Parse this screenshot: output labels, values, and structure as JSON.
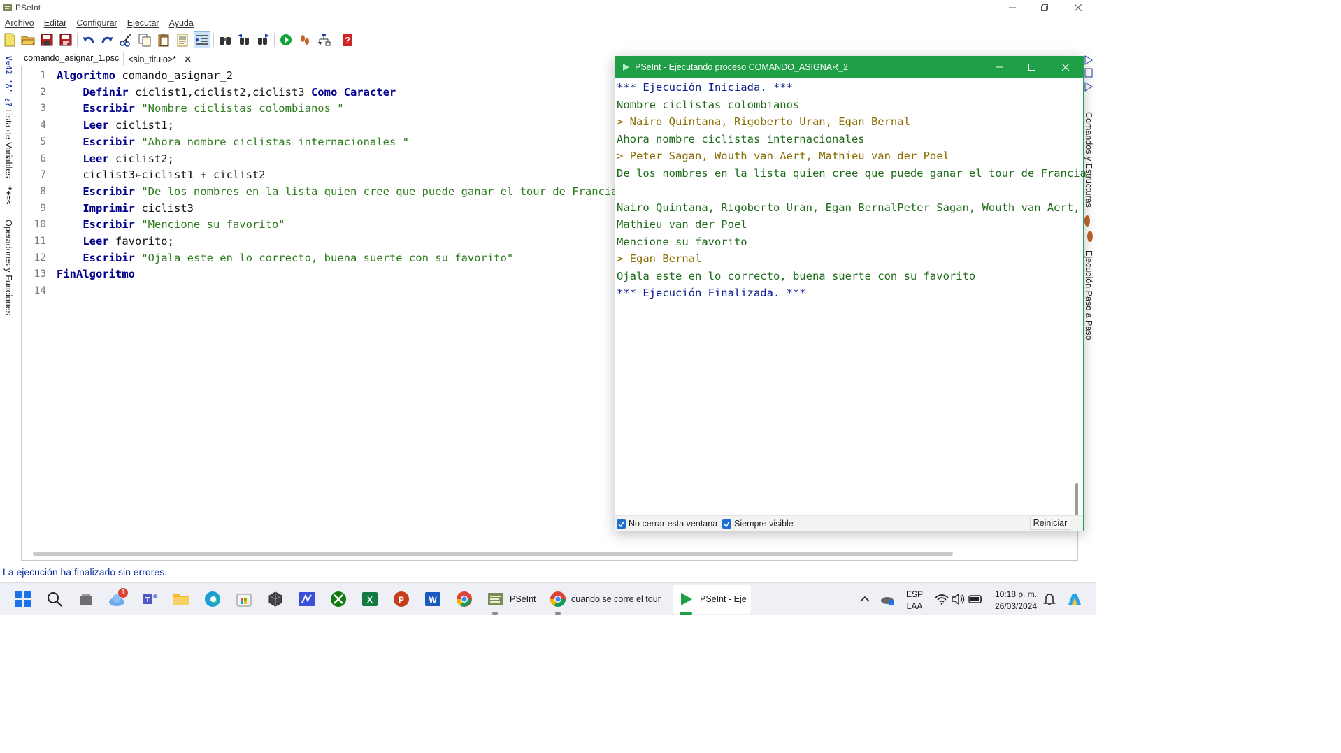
{
  "window": {
    "title": "PSeInt"
  },
  "menu": [
    "Archivo",
    "Editar",
    "Configurar",
    "Ejecutar",
    "Ayuda"
  ],
  "toolbar": {
    "icons": [
      "new-file-icon",
      "open-folder-icon",
      "save-icon",
      "save-as-icon",
      "undo-icon",
      "redo-icon",
      "cut-icon",
      "copy-icon",
      "paste-icon",
      "select-all-icon",
      "indent-icon",
      "find-icon",
      "find-previous-icon",
      "find-next-icon",
      "run-icon",
      "step-by-step-icon",
      "flowchart-icon",
      "help-icon"
    ]
  },
  "left_dock": {
    "variables_label": "Lista de Variables",
    "operators_label": "Operadores y Funciones",
    "variables_glyphs": "Ve42 'A' ¿?",
    "operators_glyphs": "*+=<"
  },
  "right_dock": {
    "commands_label": "Comandos y Estructuras",
    "step_label": "Ejecución Paso a Paso"
  },
  "tabs": [
    {
      "label": "comando_asignar_1.psc",
      "active": false
    },
    {
      "label": "<sin_titulo>*",
      "active": true,
      "close": "✕"
    }
  ],
  "editor": {
    "lines": [
      {
        "num": "1",
        "indent": "",
        "parts": [
          {
            "t": "Algoritmo",
            "c": "kw"
          },
          {
            "t": " comando_asignar_2",
            "c": ""
          }
        ]
      },
      {
        "num": "2",
        "indent": "    ",
        "parts": [
          {
            "t": "Definir",
            "c": "kw"
          },
          {
            "t": " ciclist1,ciclist2,ciclist3 ",
            "c": ""
          },
          {
            "t": "Como Caracter",
            "c": "kw"
          }
        ]
      },
      {
        "num": "3",
        "indent": "    ",
        "parts": [
          {
            "t": "Escribir",
            "c": "kw"
          },
          {
            "t": " ",
            "c": ""
          },
          {
            "t": "\"Nombre ciclistas colombianos \"",
            "c": "str"
          }
        ]
      },
      {
        "num": "4",
        "indent": "    ",
        "parts": [
          {
            "t": "Leer",
            "c": "kw"
          },
          {
            "t": " ciclist1;",
            "c": ""
          }
        ]
      },
      {
        "num": "5",
        "indent": "    ",
        "parts": [
          {
            "t": "Escribir",
            "c": "kw"
          },
          {
            "t": " ",
            "c": ""
          },
          {
            "t": "\"Ahora nombre ciclistas internacionales \"",
            "c": "str"
          }
        ]
      },
      {
        "num": "6",
        "indent": "    ",
        "parts": [
          {
            "t": "Leer",
            "c": "kw"
          },
          {
            "t": " ciclist2;",
            "c": ""
          }
        ]
      },
      {
        "num": "7",
        "indent": "    ",
        "parts": [
          {
            "t": "ciclist3←ciclist1 + ciclist2",
            "c": ""
          }
        ]
      },
      {
        "num": "8",
        "indent": "    ",
        "parts": [
          {
            "t": "Escribir",
            "c": "kw"
          },
          {
            "t": " ",
            "c": ""
          },
          {
            "t": "\"De los nombres en la lista quien cree que puede ganar el tour de Francia\"",
            "c": "str"
          }
        ]
      },
      {
        "num": "9",
        "indent": "    ",
        "parts": [
          {
            "t": "Imprimir",
            "c": "kw"
          },
          {
            "t": " ciclist3",
            "c": ""
          }
        ]
      },
      {
        "num": "10",
        "indent": "    ",
        "parts": [
          {
            "t": "Escribir",
            "c": "kw"
          },
          {
            "t": " ",
            "c": ""
          },
          {
            "t": "\"Mencione su favorito\"",
            "c": "str"
          }
        ]
      },
      {
        "num": "11",
        "indent": "    ",
        "parts": [
          {
            "t": "Leer",
            "c": "kw"
          },
          {
            "t": " favorito;",
            "c": ""
          }
        ]
      },
      {
        "num": "12",
        "indent": "    ",
        "parts": [
          {
            "t": "Escribir",
            "c": "kw"
          },
          {
            "t": " ",
            "c": ""
          },
          {
            "t": "\"Ojala este en lo correcto, buena suerte con su favorito\"",
            "c": "str"
          }
        ]
      },
      {
        "num": "13",
        "indent": "",
        "parts": [
          {
            "t": "FinAlgoritmo",
            "c": "kw"
          }
        ]
      },
      {
        "num": "14",
        "indent": "",
        "parts": []
      }
    ]
  },
  "status": "La ejecución ha finalizado sin errores.",
  "run_window": {
    "title": "PSeInt - Ejecutando proceso COMANDO_ASIGNAR_2",
    "console": [
      {
        "text": "*** Ejecución Iniciada. ***",
        "kind": "sys"
      },
      {
        "text": "Nombre ciclistas colombianos",
        "kind": "out"
      },
      {
        "text": "> Nairo Quintana, Rigoberto Uran, Egan Bernal",
        "kind": "in"
      },
      {
        "text": "Ahora nombre ciclistas internacionales",
        "kind": "out"
      },
      {
        "text": "> Peter Sagan, Wouth van Aert, Mathieu van der Poel",
        "kind": "in"
      },
      {
        "text": "De los nombres en la lista quien cree que puede ganar el tour de Francia",
        "kind": "out"
      },
      {
        "text": "",
        "kind": "out"
      },
      {
        "text": "Nairo Quintana, Rigoberto Uran, Egan BernalPeter Sagan, Wouth van Aert,",
        "kind": "out"
      },
      {
        "text": "Mathieu van der Poel",
        "kind": "out"
      },
      {
        "text": "Mencione su favorito",
        "kind": "out"
      },
      {
        "text": "> Egan Bernal",
        "kind": "in"
      },
      {
        "text": "Ojala este en lo correcto, buena suerte con su favorito",
        "kind": "out"
      },
      {
        "text": "*** Ejecución Finalizada. ***",
        "kind": "sys"
      }
    ],
    "no_close_label": "No cerrar esta ventana",
    "no_close_checked": true,
    "always_visible_label": "Siempre visible",
    "always_visible_checked": true,
    "restart_label": "Reiniciar"
  },
  "taskbar": {
    "weather_badge": "1",
    "pseint_label": "PSeInt",
    "chrome_label": "cuando se corre el tour",
    "active_label": "PSeInt - Eje",
    "lang": "ESP",
    "layout": "LAA",
    "time": "10:18 p. m.",
    "date": "26/03/2024"
  },
  "colors": {
    "keyword": "#00008b",
    "string": "#2e7d1f",
    "run_title_bg": "#1fa046",
    "console_system": "#0d1f8f",
    "console_output": "#1f6b1a",
    "console_input": "#8a6d00",
    "status_text": "#0b2a9e"
  }
}
